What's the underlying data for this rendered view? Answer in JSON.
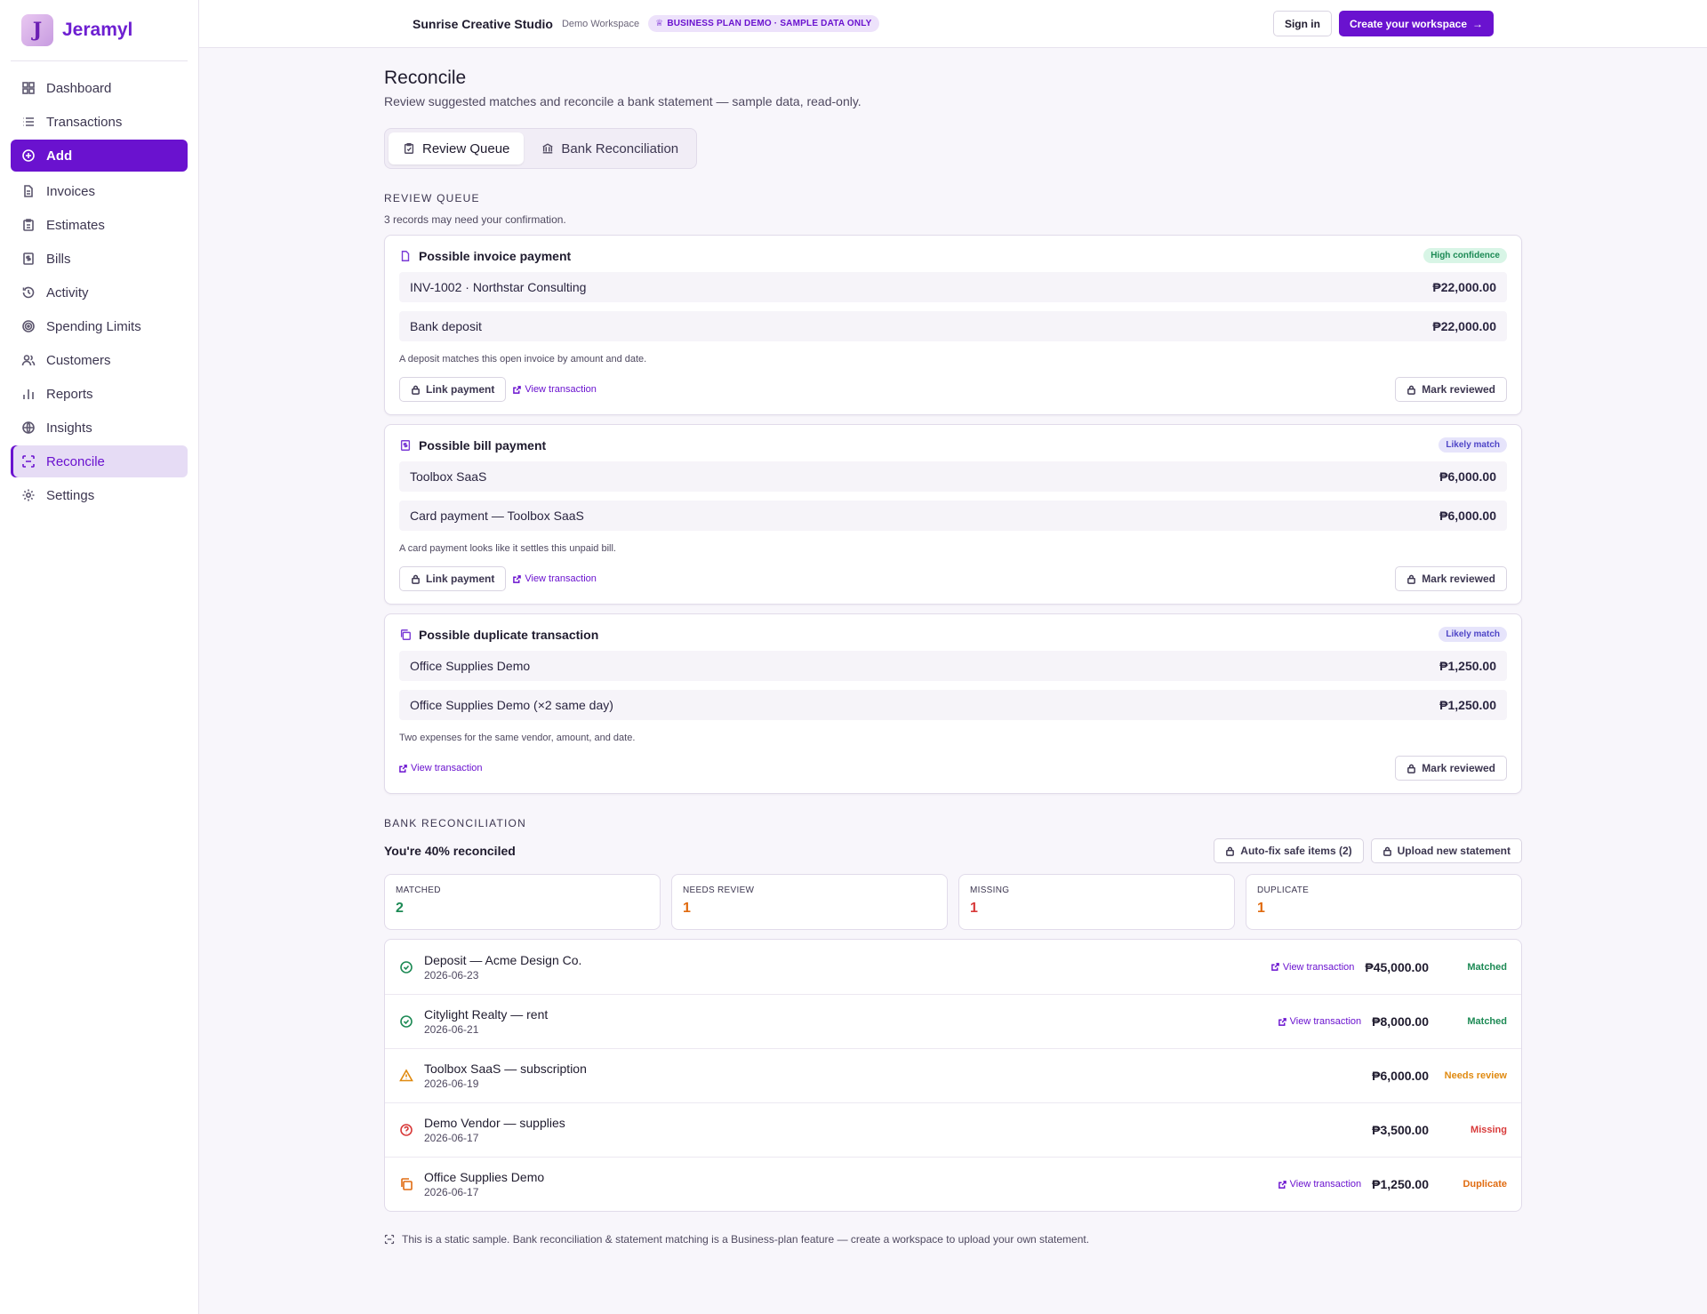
{
  "brand": {
    "name": "Jeramyl",
    "logo_letter": "J"
  },
  "sidebar": {
    "items": [
      {
        "label": "Dashboard",
        "icon": "grid-icon"
      },
      {
        "label": "Transactions",
        "icon": "list-icon"
      },
      {
        "label": "Add",
        "icon": "plus-circle-icon"
      },
      {
        "label": "Invoices",
        "icon": "file-icon"
      },
      {
        "label": "Estimates",
        "icon": "clipboard-icon"
      },
      {
        "label": "Bills",
        "icon": "receipt-icon"
      },
      {
        "label": "Activity",
        "icon": "history-icon"
      },
      {
        "label": "Spending Limits",
        "icon": "target-icon"
      },
      {
        "label": "Customers",
        "icon": "users-icon"
      },
      {
        "label": "Reports",
        "icon": "bar-chart-icon"
      },
      {
        "label": "Insights",
        "icon": "globe-icon"
      },
      {
        "label": "Reconcile",
        "icon": "scan-icon"
      },
      {
        "label": "Settings",
        "icon": "gear-icon"
      }
    ]
  },
  "topbar": {
    "workspace": "Sunrise Creative Studio",
    "workspace_sub": "Demo Workspace",
    "plan_badge": "BUSINESS PLAN DEMO · SAMPLE DATA ONLY",
    "sign_in": "Sign in",
    "create": "Create your workspace"
  },
  "page": {
    "title": "Reconcile",
    "subtitle": "Review suggested matches and reconcile a bank statement — sample data, read-only.",
    "tabs": [
      "Review Queue",
      "Bank Reconciliation"
    ]
  },
  "review": {
    "label": "REVIEW QUEUE",
    "sub": "3 records may need your confirmation.",
    "cards": [
      {
        "title": "Possible invoice payment",
        "badge": "High confidence",
        "rows": [
          {
            "label": "INV-1002 · Northstar Consulting",
            "amount": "₱22,000.00"
          },
          {
            "label": "Bank deposit",
            "amount": "₱22,000.00"
          }
        ],
        "note": "A deposit matches this open invoice by amount and date.",
        "link_payment": "Link payment",
        "view": "View transaction",
        "mark": "Mark reviewed"
      },
      {
        "title": "Possible bill payment",
        "badge": "Likely match",
        "rows": [
          {
            "label": "Toolbox SaaS",
            "amount": "₱6,000.00"
          },
          {
            "label": "Card payment — Toolbox SaaS",
            "amount": "₱6,000.00"
          }
        ],
        "note": "A card payment looks like it settles this unpaid bill.",
        "link_payment": "Link payment",
        "view": "View transaction",
        "mark": "Mark reviewed"
      },
      {
        "title": "Possible duplicate transaction",
        "badge": "Likely match",
        "rows": [
          {
            "label": "Office Supplies Demo",
            "amount": "₱1,250.00"
          },
          {
            "label": "Office Supplies Demo (×2 same day)",
            "amount": "₱1,250.00"
          }
        ],
        "note": "Two expenses for the same vendor, amount, and date.",
        "view": "View transaction",
        "mark": "Mark reviewed"
      }
    ]
  },
  "recon": {
    "label": "BANK RECONCILIATION",
    "title": "You're 40% reconciled",
    "autofix": "Auto-fix safe items (2)",
    "upload": "Upload new statement",
    "stats": [
      {
        "label": "MATCHED",
        "value": "2"
      },
      {
        "label": "NEEDS REVIEW",
        "value": "1"
      },
      {
        "label": "MISSING",
        "value": "1"
      },
      {
        "label": "DUPLICATE",
        "value": "1"
      }
    ],
    "rows": [
      {
        "desc": "Deposit — Acme Design Co.",
        "date": "2026-06-23",
        "view": "View transaction",
        "amount": "₱45,000.00",
        "status": "Matched"
      },
      {
        "desc": "Citylight Realty — rent",
        "date": "2026-06-21",
        "view": "View transaction",
        "amount": "₱8,000.00",
        "status": "Matched"
      },
      {
        "desc": "Toolbox SaaS — subscription",
        "date": "2026-06-19",
        "amount": "₱6,000.00",
        "status": "Needs review"
      },
      {
        "desc": "Demo Vendor — supplies",
        "date": "2026-06-17",
        "amount": "₱3,500.00",
        "status": "Missing"
      },
      {
        "desc": "Office Supplies Demo",
        "date": "2026-06-17",
        "view": "View transaction",
        "amount": "₱1,250.00",
        "status": "Duplicate"
      }
    ],
    "footnote": "This is a static sample. Bank reconciliation & statement matching is a Business-plan feature — create a workspace to upload your own statement."
  },
  "colors": {
    "accent": "#6a12cf",
    "matched": "#1d8a55",
    "review": "#e06b10",
    "missing": "#d83a3a",
    "duplicate": "#e06b10"
  }
}
